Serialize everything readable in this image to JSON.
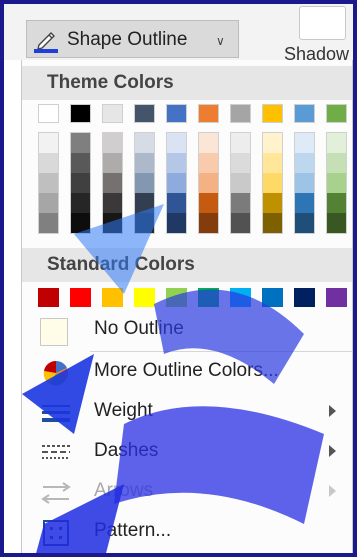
{
  "ribbon": {
    "shape_outline_label": "Shape Outline",
    "dropdown_glyph": "∨",
    "shadow_label": "Shadow"
  },
  "menu": {
    "theme_colors_header": "Theme Colors",
    "standard_colors_header": "Standard Colors",
    "theme_top": [
      "#ffffff",
      "#000000",
      "#e7e6e6",
      "#44546a",
      "#4472c4",
      "#ed7d31",
      "#a5a5a5",
      "#ffc000",
      "#5b9bd5",
      "#70ad47"
    ],
    "theme_shades": [
      [
        "#f2f2f2",
        "#d9d9d9",
        "#bfbfbf",
        "#a6a6a6",
        "#808080"
      ],
      [
        "#7f7f7f",
        "#595959",
        "#404040",
        "#262626",
        "#0d0d0d"
      ],
      [
        "#d0cece",
        "#aeabab",
        "#757171",
        "#3a3838",
        "#171616"
      ],
      [
        "#d6dce5",
        "#adb9ca",
        "#8497b0",
        "#333f50",
        "#222a35"
      ],
      [
        "#dae3f3",
        "#b4c7e7",
        "#8faadc",
        "#2f5597",
        "#203864"
      ],
      [
        "#fbe5d6",
        "#f8cbad",
        "#f4b183",
        "#c55a11",
        "#843c0c"
      ],
      [
        "#ededed",
        "#dbdbdb",
        "#c9c9c9",
        "#7b7b7b",
        "#525252"
      ],
      [
        "#fff2cc",
        "#ffe699",
        "#ffd966",
        "#bf9000",
        "#7f6000"
      ],
      [
        "#deebf7",
        "#bdd7ee",
        "#9dc3e6",
        "#2e75b6",
        "#1f4e79"
      ],
      [
        "#e2f0d9",
        "#c5e0b4",
        "#a9d18e",
        "#548235",
        "#385723"
      ]
    ],
    "standard": [
      "#c00000",
      "#ff0000",
      "#ffc000",
      "#ffff00",
      "#92d050",
      "#00b050",
      "#00b0f0",
      "#0070c0",
      "#002060",
      "#7030a0"
    ],
    "items": [
      {
        "label": "No Outline",
        "icon": "no-outline-swatch"
      },
      {
        "label": "More Outline Colors...",
        "icon": "color-wheel-icon"
      },
      {
        "label": "Weight",
        "icon": "weight-lines-icon"
      },
      {
        "label": "Dashes",
        "icon": "dashes-icon"
      },
      {
        "label": "Arrows",
        "icon": "arrows-icon",
        "disabled": true
      },
      {
        "label": "Pattern...",
        "icon": "pattern-icon"
      }
    ]
  }
}
